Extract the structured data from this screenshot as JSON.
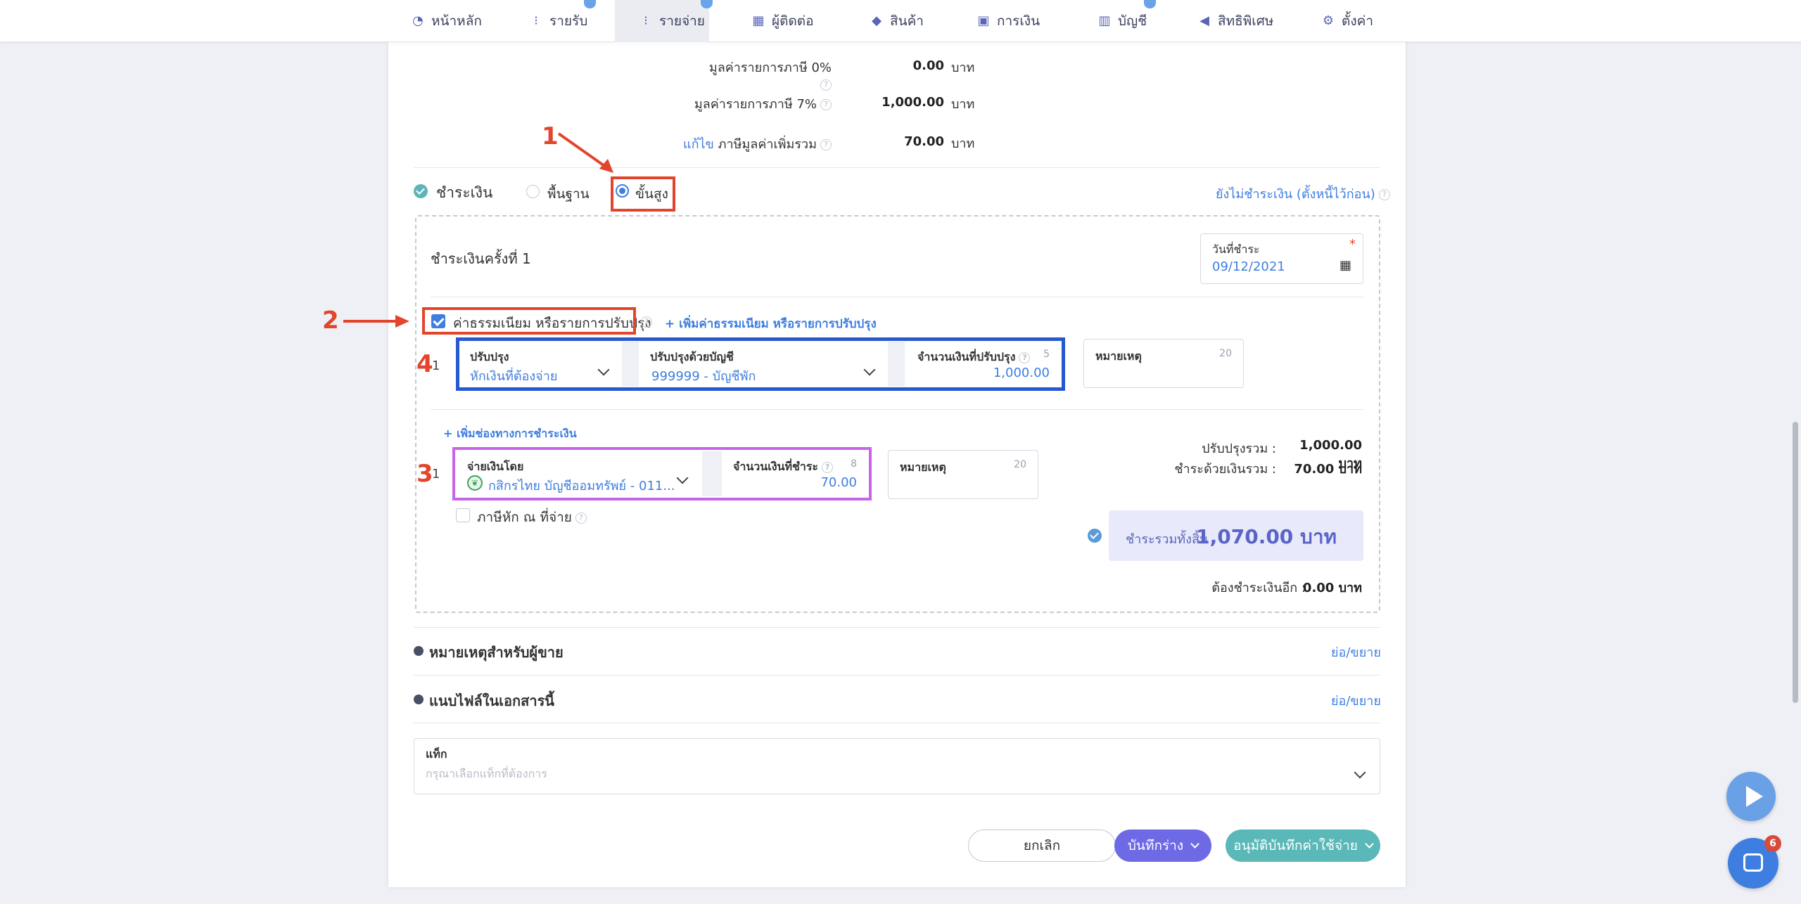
{
  "nav": {
    "items": [
      {
        "label": "หน้าหลัก",
        "icon": "speedometer-icon"
      },
      {
        "label": "รายรับ",
        "icon": "list-sort-icon"
      },
      {
        "label": "รายจ่าย",
        "icon": "list-sort-icon"
      },
      {
        "label": "ผู้ติดต่อ",
        "icon": "building-icon"
      },
      {
        "label": "สินค้า",
        "icon": "box-icon"
      },
      {
        "label": "การเงิน",
        "icon": "money-icon"
      },
      {
        "label": "บัญชี",
        "icon": "book-icon"
      },
      {
        "label": "สิทธิพิเศษ",
        "icon": "megaphone-icon"
      },
      {
        "label": "ตั้งค่า",
        "icon": "gear-icon"
      }
    ]
  },
  "summary": {
    "vat0_label": "มูลค่ารายการภาษี 0%",
    "vat0_value": "0.00",
    "vat7_label": "มูลค่ารายการภาษี 7%",
    "vat7_value": "1,000.00",
    "edit_label": "แก้ไข",
    "vat_total_label": "ภาษีมูลค่าเพิ่มรวม",
    "vat_total_value": "70.00",
    "currency": "บาท"
  },
  "payment": {
    "title": "ชำระเงิน",
    "mode_basic": "พื้นฐาน",
    "mode_advanced": "ขั้นสูง",
    "unpaid_link": "ยังไม่ชำระเงิน (ตั้งหนี้ไว้ก่อน)",
    "installment_title": "ชำระเงินครั้งที่ 1",
    "date_label": "วันที่ชำระ",
    "date_value": "09/12/2021",
    "fee_checkbox_label": "ค่าธรรมเนียม หรือรายการปรับปรุง",
    "add_fee_link": "+ เพิ่มค่าธรรมเนียม หรือรายการปรับปรุง",
    "adj_row_index": "1",
    "adj_label": "ปรับปรุง",
    "adj_value": "หักเงินที่ต้องจ่าย",
    "adj_account_label": "ปรับปรุงด้วยบัญชี",
    "adj_account_value": "999999 - บัญชีพัก",
    "adj_amount_label": "จำนวนเงินที่ปรับปรุง",
    "adj_amount_count": "5",
    "adj_amount_value": "1,000.00",
    "note_label": "หมายเหตุ",
    "note1_count": "20",
    "add_channel_link": "+ เพิ่มช่องทางการชำระเงิน",
    "pay_row_index": "1",
    "pay_by_label": "จ่ายเงินโดย",
    "pay_by_value": "กสิกรไทย บัญชีออมทรัพย์ - 011...",
    "pay_amount_label": "จำนวนเงินที่ชำระ",
    "pay_amount_count": "8",
    "pay_amount_value": "70.00",
    "note2_count": "20",
    "wht_label": "ภาษีหัก ณ ที่จ่าย",
    "adj_total_label": "ปรับปรุงรวม :",
    "adj_total_value": "1,000.00 บาท",
    "paid_total_label": "ชำระด้วยเงินรวม :",
    "paid_total_value": "70.00 บาท",
    "grand_total_label": "ชำระรวมทั้งสิ้น",
    "grand_total_value": "1,070.00 บาท",
    "remaining_label": "ต้องชำระเงินอีก :",
    "remaining_value": "0.00 บาท"
  },
  "sections": {
    "seller_note": "หมายเหตุสำหรับผู้ขาย",
    "attach": "แนบไฟล์ในเอกสารนี้",
    "toggle": "ย่อ/ขยาย"
  },
  "tags": {
    "label": "แท็ก",
    "placeholder": "กรุณาเลือกแท็กที่ต้องการ"
  },
  "actions": {
    "cancel": "ยกเลิก",
    "draft": "บันทึกร่าง",
    "approve": "อนุมัติบันทึกค่าใช้จ่าย"
  },
  "annotations": {
    "a1": "1",
    "a2": "2",
    "a3": "3",
    "a4": "4"
  },
  "chat": {
    "badge": "6"
  },
  "colors": {
    "accent": "#3d7ee0",
    "annotation_red": "#e2452c",
    "annotation_blue": "#2659d0",
    "annotation_purple": "#c765e8",
    "approve": "#5bb8b8",
    "draft": "#6e6ae6"
  }
}
